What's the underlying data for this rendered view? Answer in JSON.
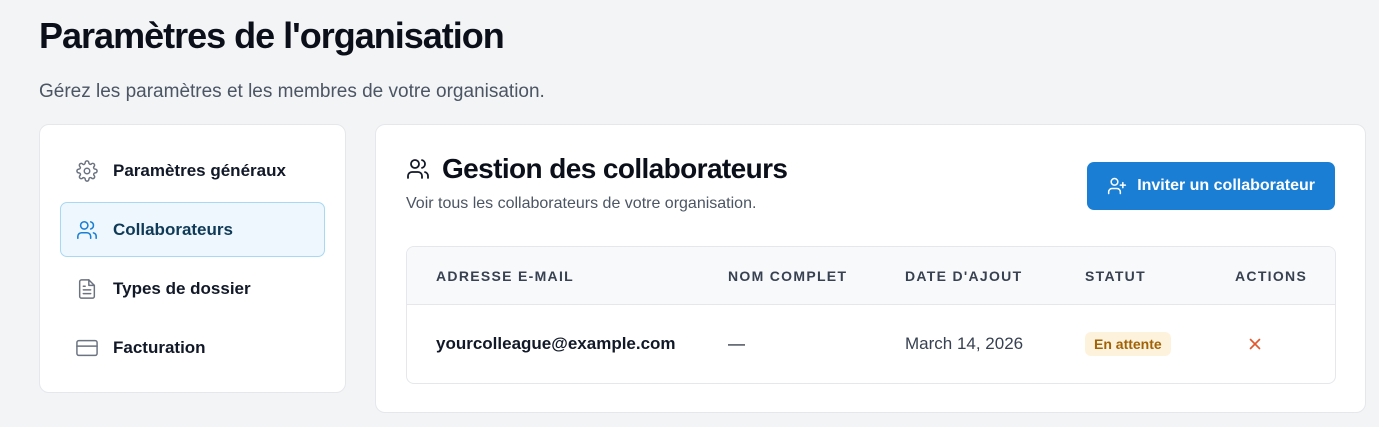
{
  "page": {
    "title": "Paramètres de l'organisation",
    "subtitle": "Gérez les paramètres et les membres de votre organisation."
  },
  "sidebar": {
    "items": [
      {
        "label": "Paramètres généraux",
        "icon": "gear-icon",
        "active": false
      },
      {
        "label": "Collaborateurs",
        "icon": "users-icon",
        "active": true
      },
      {
        "label": "Types de dossier",
        "icon": "document-icon",
        "active": false
      },
      {
        "label": "Facturation",
        "icon": "credit-card-icon",
        "active": false
      }
    ]
  },
  "collaborators": {
    "title": "Gestion des collaborateurs",
    "subtitle": "Voir tous les collaborateurs de votre organisation.",
    "invite_label": "Inviter un collaborateur",
    "columns": [
      "ADRESSE E-MAIL",
      "NOM COMPLET",
      "DATE D'AJOUT",
      "STATUT",
      "ACTIONS"
    ],
    "rows": [
      {
        "email": "yourcolleague@example.com",
        "full_name": "—",
        "date_added": "March 14, 2026",
        "status": "En attente"
      }
    ]
  },
  "colors": {
    "accent": "#1a7fd4",
    "active_nav_bg": "#eef7fd",
    "pending_badge_bg": "#fdf3dc",
    "pending_badge_text": "#a16207",
    "remove_icon": "#e4572e"
  }
}
